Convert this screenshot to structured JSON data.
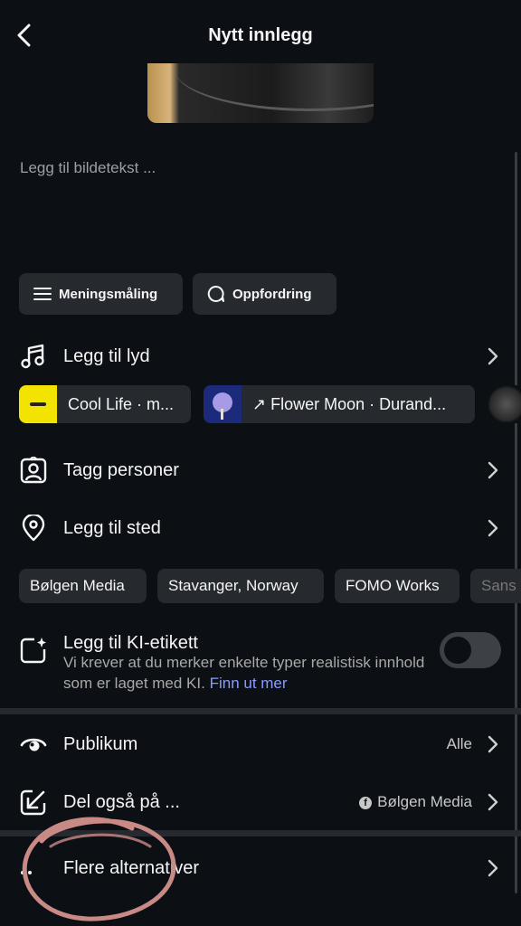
{
  "header": {
    "title": "Nytt innlegg"
  },
  "caption": {
    "placeholder": "Legg til bildetekst ..."
  },
  "quick_actions": {
    "poll": "Meningsmåling",
    "prompt": "Oppfordring"
  },
  "audio": {
    "label": "Legg til lyd",
    "suggestions": [
      "Cool Life · m...",
      "↗ Flower Moon · Durand..."
    ]
  },
  "tag_people": {
    "label": "Tagg personer"
  },
  "location": {
    "label": "Legg til sted",
    "suggestions": [
      "Bølgen Media",
      "Stavanger, Norway",
      "FOMO Works",
      "Sans"
    ]
  },
  "ai_label": {
    "label": "Legg til KI-etikett",
    "description": "Vi krever at du merker enkelte typer realistisk innhold som er laget med KI.",
    "link": "Finn ut mer",
    "toggle_on": false
  },
  "audience": {
    "label": "Publikum",
    "value": "Alle"
  },
  "share": {
    "label": "Del også på ...",
    "value": "Bølgen Media"
  },
  "more": {
    "label": "Flere alternativer"
  },
  "colors": {
    "background": "#0c1014",
    "chip": "#262a2f",
    "link": "#8a9bff",
    "annotation": "#c98a86"
  }
}
